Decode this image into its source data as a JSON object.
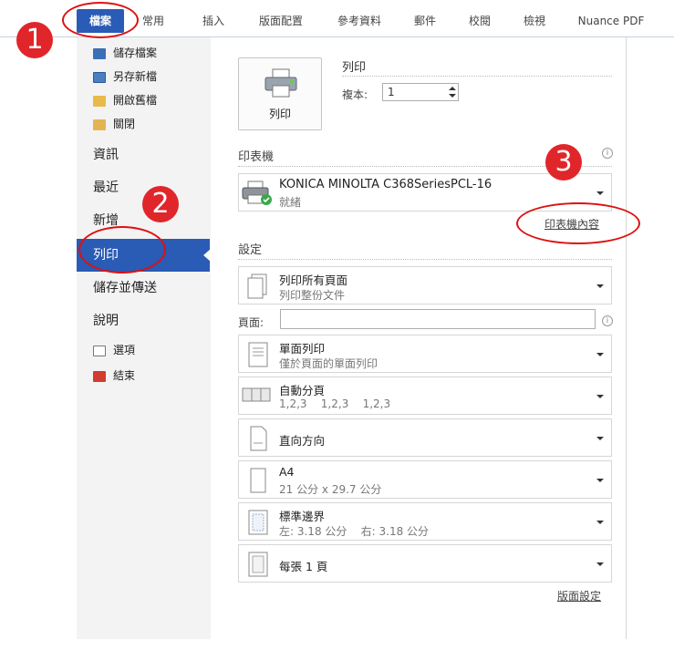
{
  "ribbon": {
    "tabs": [
      {
        "label": "檔案",
        "active": true
      },
      {
        "label": "常用"
      },
      {
        "label": "插入"
      },
      {
        "label": "版面配置"
      },
      {
        "label": "參考資料"
      },
      {
        "label": "郵件"
      },
      {
        "label": "校閱"
      },
      {
        "label": "檢視"
      },
      {
        "label": "Nuance PDF"
      }
    ]
  },
  "sidebar": {
    "items_small_top": [
      {
        "label": "儲存檔案",
        "icon": "save-icon"
      },
      {
        "label": "另存新檔",
        "icon": "save-as-icon"
      },
      {
        "label": "開啟舊檔",
        "icon": "open-folder-icon"
      },
      {
        "label": "關閉",
        "icon": "close-folder-icon"
      }
    ],
    "items_big": [
      "資訊",
      "最近",
      "新增"
    ],
    "selected": "列印",
    "items_big_after": [
      "儲存並傳送",
      "說明"
    ],
    "items_small_bottom": [
      {
        "label": "選項",
        "icon": "options-icon"
      },
      {
        "label": "結束",
        "icon": "exit-icon"
      }
    ]
  },
  "print": {
    "button_label": "列印",
    "section_title": "列印",
    "copies_label": "複本:",
    "copies_value": "1"
  },
  "printer": {
    "section_title": "印表機",
    "name": "KONICA MINOLTA C368SeriesPCL-16",
    "status": "就緒",
    "properties_link": "印表機內容"
  },
  "settings": {
    "section_title": "設定",
    "pages_label": "頁面:",
    "dropdowns": [
      {
        "t1": "列印所有頁面",
        "t2": "列印整份文件",
        "icon": "pages-icon"
      },
      {
        "t1": "單面列印",
        "t2": "僅於頁面的單面列印",
        "icon": "single-side-icon"
      },
      {
        "t1": "自動分頁",
        "t2": "1,2,3    1,2,3    1,2,3",
        "icon": "collate-icon"
      },
      {
        "t1": "直向方向",
        "t2": "",
        "icon": "portrait-icon"
      },
      {
        "t1": "A4",
        "t2": "21 公分 x 29.7 公分",
        "icon": "paper-size-icon"
      },
      {
        "t1": "標準邊界",
        "t2": "左: 3.18 公分    右: 3.18 公分",
        "icon": "margins-icon"
      },
      {
        "t1": "每張 1 頁",
        "t2": "",
        "icon": "pages-per-sheet-icon"
      }
    ],
    "page_setup_link": "版面設定"
  },
  "annotations": {
    "markers": [
      "1",
      "2",
      "3"
    ],
    "color": "#e0262a"
  }
}
